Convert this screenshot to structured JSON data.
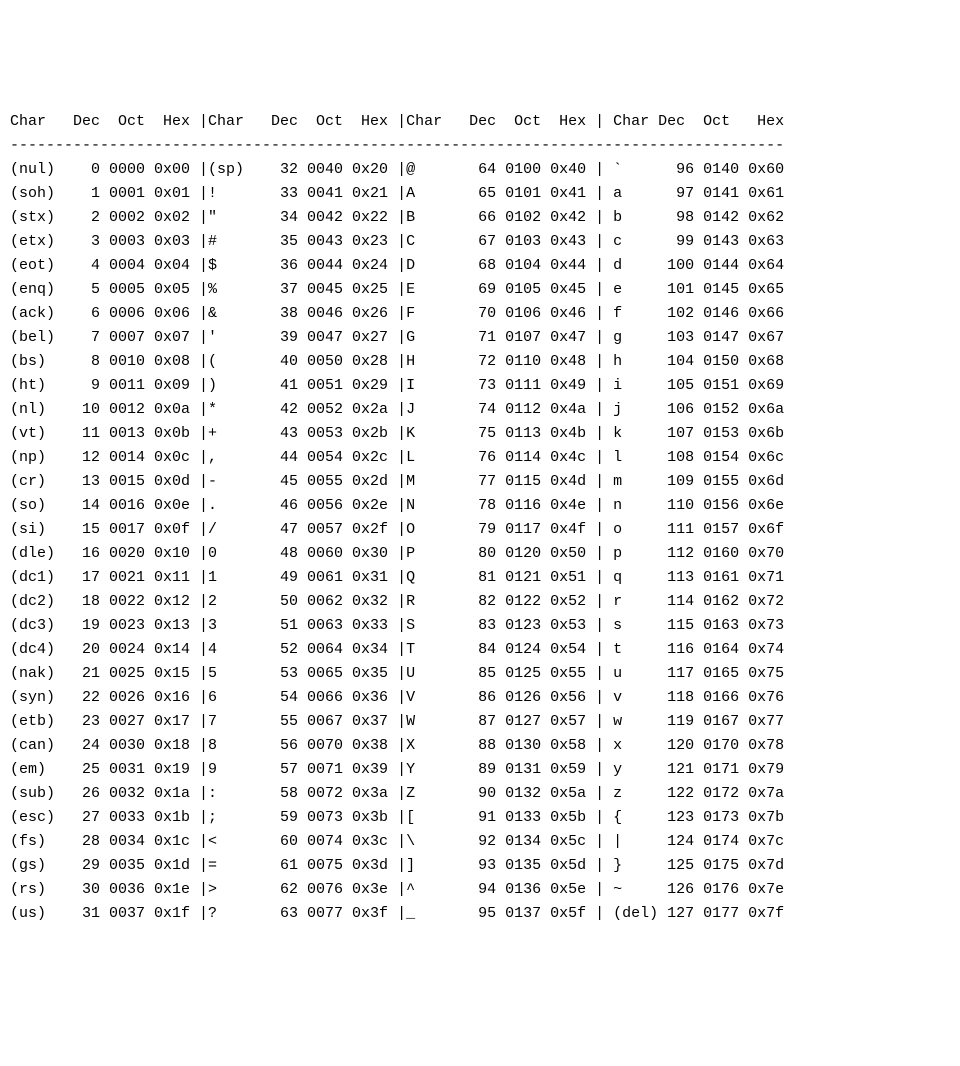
{
  "headers": [
    "Char",
    "Dec",
    "Oct",
    "Hex"
  ],
  "divider_char": "-",
  "column_groups": 4,
  "chart_data": {
    "type": "table",
    "title": "ASCII Table",
    "columns": [
      "Char",
      "Dec",
      "Oct",
      "Hex"
    ],
    "rows": [
      {
        "char": "(nul)",
        "dec": 0,
        "oct": "0000",
        "hex": "0x00"
      },
      {
        "char": "(soh)",
        "dec": 1,
        "oct": "0001",
        "hex": "0x01"
      },
      {
        "char": "(stx)",
        "dec": 2,
        "oct": "0002",
        "hex": "0x02"
      },
      {
        "char": "(etx)",
        "dec": 3,
        "oct": "0003",
        "hex": "0x03"
      },
      {
        "char": "(eot)",
        "dec": 4,
        "oct": "0004",
        "hex": "0x04"
      },
      {
        "char": "(enq)",
        "dec": 5,
        "oct": "0005",
        "hex": "0x05"
      },
      {
        "char": "(ack)",
        "dec": 6,
        "oct": "0006",
        "hex": "0x06"
      },
      {
        "char": "(bel)",
        "dec": 7,
        "oct": "0007",
        "hex": "0x07"
      },
      {
        "char": "(bs)",
        "dec": 8,
        "oct": "0010",
        "hex": "0x08"
      },
      {
        "char": "(ht)",
        "dec": 9,
        "oct": "0011",
        "hex": "0x09"
      },
      {
        "char": "(nl)",
        "dec": 10,
        "oct": "0012",
        "hex": "0x0a"
      },
      {
        "char": "(vt)",
        "dec": 11,
        "oct": "0013",
        "hex": "0x0b"
      },
      {
        "char": "(np)",
        "dec": 12,
        "oct": "0014",
        "hex": "0x0c"
      },
      {
        "char": "(cr)",
        "dec": 13,
        "oct": "0015",
        "hex": "0x0d"
      },
      {
        "char": "(so)",
        "dec": 14,
        "oct": "0016",
        "hex": "0x0e"
      },
      {
        "char": "(si)",
        "dec": 15,
        "oct": "0017",
        "hex": "0x0f"
      },
      {
        "char": "(dle)",
        "dec": 16,
        "oct": "0020",
        "hex": "0x10"
      },
      {
        "char": "(dc1)",
        "dec": 17,
        "oct": "0021",
        "hex": "0x11"
      },
      {
        "char": "(dc2)",
        "dec": 18,
        "oct": "0022",
        "hex": "0x12"
      },
      {
        "char": "(dc3)",
        "dec": 19,
        "oct": "0023",
        "hex": "0x13"
      },
      {
        "char": "(dc4)",
        "dec": 20,
        "oct": "0024",
        "hex": "0x14"
      },
      {
        "char": "(nak)",
        "dec": 21,
        "oct": "0025",
        "hex": "0x15"
      },
      {
        "char": "(syn)",
        "dec": 22,
        "oct": "0026",
        "hex": "0x16"
      },
      {
        "char": "(etb)",
        "dec": 23,
        "oct": "0027",
        "hex": "0x17"
      },
      {
        "char": "(can)",
        "dec": 24,
        "oct": "0030",
        "hex": "0x18"
      },
      {
        "char": "(em)",
        "dec": 25,
        "oct": "0031",
        "hex": "0x19"
      },
      {
        "char": "(sub)",
        "dec": 26,
        "oct": "0032",
        "hex": "0x1a"
      },
      {
        "char": "(esc)",
        "dec": 27,
        "oct": "0033",
        "hex": "0x1b"
      },
      {
        "char": "(fs)",
        "dec": 28,
        "oct": "0034",
        "hex": "0x1c"
      },
      {
        "char": "(gs)",
        "dec": 29,
        "oct": "0035",
        "hex": "0x1d"
      },
      {
        "char": "(rs)",
        "dec": 30,
        "oct": "0036",
        "hex": "0x1e"
      },
      {
        "char": "(us)",
        "dec": 31,
        "oct": "0037",
        "hex": "0x1f"
      },
      {
        "char": "(sp)",
        "dec": 32,
        "oct": "0040",
        "hex": "0x20"
      },
      {
        "char": "!",
        "dec": 33,
        "oct": "0041",
        "hex": "0x21"
      },
      {
        "char": "\"",
        "dec": 34,
        "oct": "0042",
        "hex": "0x22"
      },
      {
        "char": "#",
        "dec": 35,
        "oct": "0043",
        "hex": "0x23"
      },
      {
        "char": "$",
        "dec": 36,
        "oct": "0044",
        "hex": "0x24"
      },
      {
        "char": "%",
        "dec": 37,
        "oct": "0045",
        "hex": "0x25"
      },
      {
        "char": "&",
        "dec": 38,
        "oct": "0046",
        "hex": "0x26"
      },
      {
        "char": "'",
        "dec": 39,
        "oct": "0047",
        "hex": "0x27"
      },
      {
        "char": "(",
        "dec": 40,
        "oct": "0050",
        "hex": "0x28"
      },
      {
        "char": ")",
        "dec": 41,
        "oct": "0051",
        "hex": "0x29"
      },
      {
        "char": "*",
        "dec": 42,
        "oct": "0052",
        "hex": "0x2a"
      },
      {
        "char": "+",
        "dec": 43,
        "oct": "0053",
        "hex": "0x2b"
      },
      {
        "char": ",",
        "dec": 44,
        "oct": "0054",
        "hex": "0x2c"
      },
      {
        "char": "-",
        "dec": 45,
        "oct": "0055",
        "hex": "0x2d"
      },
      {
        "char": ".",
        "dec": 46,
        "oct": "0056",
        "hex": "0x2e"
      },
      {
        "char": "/",
        "dec": 47,
        "oct": "0057",
        "hex": "0x2f"
      },
      {
        "char": "0",
        "dec": 48,
        "oct": "0060",
        "hex": "0x30"
      },
      {
        "char": "1",
        "dec": 49,
        "oct": "0061",
        "hex": "0x31"
      },
      {
        "char": "2",
        "dec": 50,
        "oct": "0062",
        "hex": "0x32"
      },
      {
        "char": "3",
        "dec": 51,
        "oct": "0063",
        "hex": "0x33"
      },
      {
        "char": "4",
        "dec": 52,
        "oct": "0064",
        "hex": "0x34"
      },
      {
        "char": "5",
        "dec": 53,
        "oct": "0065",
        "hex": "0x35"
      },
      {
        "char": "6",
        "dec": 54,
        "oct": "0066",
        "hex": "0x36"
      },
      {
        "char": "7",
        "dec": 55,
        "oct": "0067",
        "hex": "0x37"
      },
      {
        "char": "8",
        "dec": 56,
        "oct": "0070",
        "hex": "0x38"
      },
      {
        "char": "9",
        "dec": 57,
        "oct": "0071",
        "hex": "0x39"
      },
      {
        "char": ":",
        "dec": 58,
        "oct": "0072",
        "hex": "0x3a"
      },
      {
        "char": ";",
        "dec": 59,
        "oct": "0073",
        "hex": "0x3b"
      },
      {
        "char": "<",
        "dec": 60,
        "oct": "0074",
        "hex": "0x3c"
      },
      {
        "char": "=",
        "dec": 61,
        "oct": "0075",
        "hex": "0x3d"
      },
      {
        "char": ">",
        "dec": 62,
        "oct": "0076",
        "hex": "0x3e"
      },
      {
        "char": "?",
        "dec": 63,
        "oct": "0077",
        "hex": "0x3f"
      },
      {
        "char": "@",
        "dec": 64,
        "oct": "0100",
        "hex": "0x40"
      },
      {
        "char": "A",
        "dec": 65,
        "oct": "0101",
        "hex": "0x41"
      },
      {
        "char": "B",
        "dec": 66,
        "oct": "0102",
        "hex": "0x42"
      },
      {
        "char": "C",
        "dec": 67,
        "oct": "0103",
        "hex": "0x43"
      },
      {
        "char": "D",
        "dec": 68,
        "oct": "0104",
        "hex": "0x44"
      },
      {
        "char": "E",
        "dec": 69,
        "oct": "0105",
        "hex": "0x45"
      },
      {
        "char": "F",
        "dec": 70,
        "oct": "0106",
        "hex": "0x46"
      },
      {
        "char": "G",
        "dec": 71,
        "oct": "0107",
        "hex": "0x47"
      },
      {
        "char": "H",
        "dec": 72,
        "oct": "0110",
        "hex": "0x48"
      },
      {
        "char": "I",
        "dec": 73,
        "oct": "0111",
        "hex": "0x49"
      },
      {
        "char": "J",
        "dec": 74,
        "oct": "0112",
        "hex": "0x4a"
      },
      {
        "char": "K",
        "dec": 75,
        "oct": "0113",
        "hex": "0x4b"
      },
      {
        "char": "L",
        "dec": 76,
        "oct": "0114",
        "hex": "0x4c"
      },
      {
        "char": "M",
        "dec": 77,
        "oct": "0115",
        "hex": "0x4d"
      },
      {
        "char": "N",
        "dec": 78,
        "oct": "0116",
        "hex": "0x4e"
      },
      {
        "char": "O",
        "dec": 79,
        "oct": "0117",
        "hex": "0x4f"
      },
      {
        "char": "P",
        "dec": 80,
        "oct": "0120",
        "hex": "0x50"
      },
      {
        "char": "Q",
        "dec": 81,
        "oct": "0121",
        "hex": "0x51"
      },
      {
        "char": "R",
        "dec": 82,
        "oct": "0122",
        "hex": "0x52"
      },
      {
        "char": "S",
        "dec": 83,
        "oct": "0123",
        "hex": "0x53"
      },
      {
        "char": "T",
        "dec": 84,
        "oct": "0124",
        "hex": "0x54"
      },
      {
        "char": "U",
        "dec": 85,
        "oct": "0125",
        "hex": "0x55"
      },
      {
        "char": "V",
        "dec": 86,
        "oct": "0126",
        "hex": "0x56"
      },
      {
        "char": "W",
        "dec": 87,
        "oct": "0127",
        "hex": "0x57"
      },
      {
        "char": "X",
        "dec": 88,
        "oct": "0130",
        "hex": "0x58"
      },
      {
        "char": "Y",
        "dec": 89,
        "oct": "0131",
        "hex": "0x59"
      },
      {
        "char": "Z",
        "dec": 90,
        "oct": "0132",
        "hex": "0x5a"
      },
      {
        "char": "[",
        "dec": 91,
        "oct": "0133",
        "hex": "0x5b"
      },
      {
        "char": "\\",
        "dec": 92,
        "oct": "0134",
        "hex": "0x5c"
      },
      {
        "char": "]",
        "dec": 93,
        "oct": "0135",
        "hex": "0x5d"
      },
      {
        "char": "^",
        "dec": 94,
        "oct": "0136",
        "hex": "0x5e"
      },
      {
        "char": "_",
        "dec": 95,
        "oct": "0137",
        "hex": "0x5f"
      },
      {
        "char": "`",
        "dec": 96,
        "oct": "0140",
        "hex": "0x60"
      },
      {
        "char": "a",
        "dec": 97,
        "oct": "0141",
        "hex": "0x61"
      },
      {
        "char": "b",
        "dec": 98,
        "oct": "0142",
        "hex": "0x62"
      },
      {
        "char": "c",
        "dec": 99,
        "oct": "0143",
        "hex": "0x63"
      },
      {
        "char": "d",
        "dec": 100,
        "oct": "0144",
        "hex": "0x64"
      },
      {
        "char": "e",
        "dec": 101,
        "oct": "0145",
        "hex": "0x65"
      },
      {
        "char": "f",
        "dec": 102,
        "oct": "0146",
        "hex": "0x66"
      },
      {
        "char": "g",
        "dec": 103,
        "oct": "0147",
        "hex": "0x67"
      },
      {
        "char": "h",
        "dec": 104,
        "oct": "0150",
        "hex": "0x68"
      },
      {
        "char": "i",
        "dec": 105,
        "oct": "0151",
        "hex": "0x69"
      },
      {
        "char": "j",
        "dec": 106,
        "oct": "0152",
        "hex": "0x6a"
      },
      {
        "char": "k",
        "dec": 107,
        "oct": "0153",
        "hex": "0x6b"
      },
      {
        "char": "l",
        "dec": 108,
        "oct": "0154",
        "hex": "0x6c"
      },
      {
        "char": "m",
        "dec": 109,
        "oct": "0155",
        "hex": "0x6d"
      },
      {
        "char": "n",
        "dec": 110,
        "oct": "0156",
        "hex": "0x6e"
      },
      {
        "char": "o",
        "dec": 111,
        "oct": "0157",
        "hex": "0x6f"
      },
      {
        "char": "p",
        "dec": 112,
        "oct": "0160",
        "hex": "0x70"
      },
      {
        "char": "q",
        "dec": 113,
        "oct": "0161",
        "hex": "0x71"
      },
      {
        "char": "r",
        "dec": 114,
        "oct": "0162",
        "hex": "0x72"
      },
      {
        "char": "s",
        "dec": 115,
        "oct": "0163",
        "hex": "0x73"
      },
      {
        "char": "t",
        "dec": 116,
        "oct": "0164",
        "hex": "0x74"
      },
      {
        "char": "u",
        "dec": 117,
        "oct": "0165",
        "hex": "0x75"
      },
      {
        "char": "v",
        "dec": 118,
        "oct": "0166",
        "hex": "0x76"
      },
      {
        "char": "w",
        "dec": 119,
        "oct": "0167",
        "hex": "0x77"
      },
      {
        "char": "x",
        "dec": 120,
        "oct": "0170",
        "hex": "0x78"
      },
      {
        "char": "y",
        "dec": 121,
        "oct": "0171",
        "hex": "0x79"
      },
      {
        "char": "z",
        "dec": 122,
        "oct": "0172",
        "hex": "0x7a"
      },
      {
        "char": "{",
        "dec": 123,
        "oct": "0173",
        "hex": "0x7b"
      },
      {
        "char": "|",
        "dec": 124,
        "oct": "0174",
        "hex": "0x7c"
      },
      {
        "char": "}",
        "dec": 125,
        "oct": "0175",
        "hex": "0x7d"
      },
      {
        "char": "~",
        "dec": 126,
        "oct": "0176",
        "hex": "0x7e"
      },
      {
        "char": "(del)",
        "dec": 127,
        "oct": "0177",
        "hex": "0x7f"
      }
    ]
  }
}
